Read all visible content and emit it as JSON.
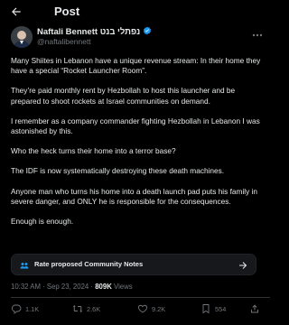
{
  "header": {
    "title": "Post"
  },
  "author": {
    "name": "Naftali Bennett נפתלי בנט",
    "handle": "@naftalibennett"
  },
  "post": {
    "paragraphs": [
      "Many Shiites in Lebanon have a unique revenue stream: In their home they have a special “Rocket Launcher Room”.",
      "They’re paid monthly rent by Hezbollah to host this launcher and be prepared to shoot rockets at Israel communities on demand.",
      "I remember as a company commander fighting Hezbollah in Lebanon I was astonished by this.",
      "Who the heck turns their home into a terror base?",
      "The IDF is now systematically destroying these death machines.",
      "Anyone man who turns his home into a death launch pad puts his family in severe danger, and ONLY he is responsible for the consequences.",
      "Enough is enough."
    ]
  },
  "community_notes": {
    "label": "Rate proposed Community Notes"
  },
  "meta": {
    "time_date": "10:32 AM · Sep 23, 2024 · ",
    "views_count": "809K",
    "views_label": " Views"
  },
  "actions": {
    "replies": "1.1K",
    "reposts": "2.6K",
    "likes": "9.2K",
    "bookmarks": "554"
  },
  "colors": {
    "background": "#000000",
    "text": "#e7e9ea",
    "muted": "#71767b",
    "verified": "#1d9bf0",
    "divider": "#2f3336"
  }
}
